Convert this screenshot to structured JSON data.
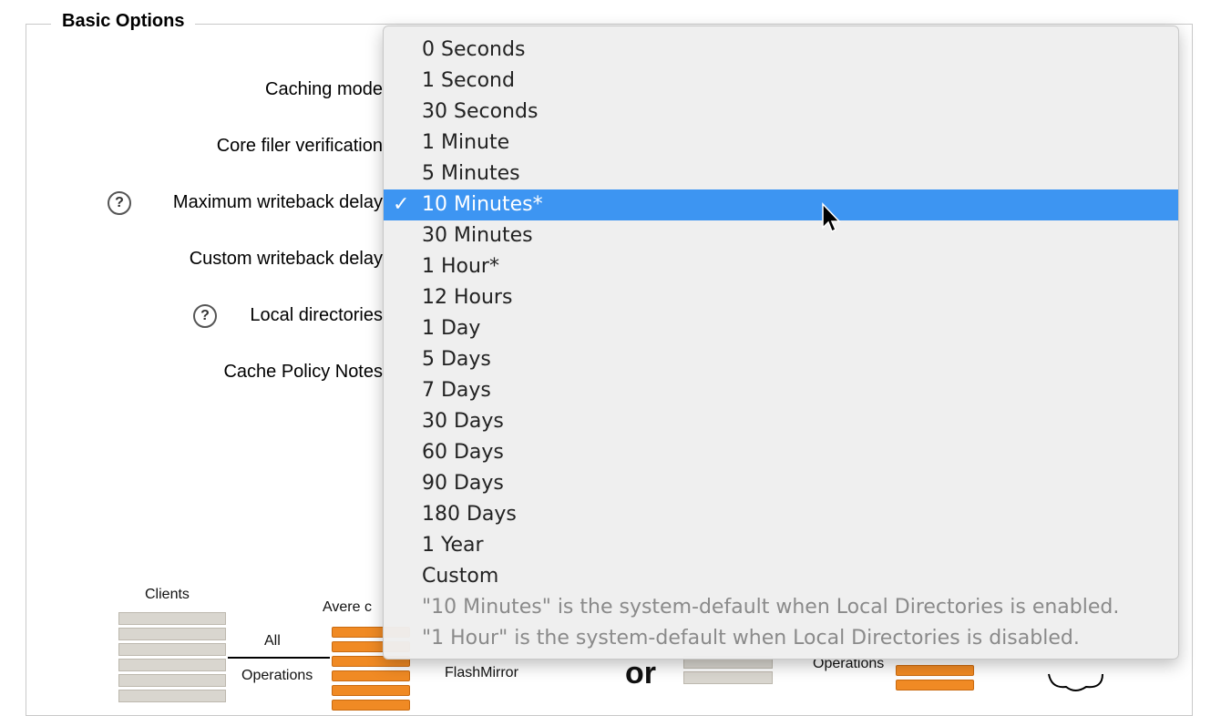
{
  "fieldset": {
    "legend": "Basic Options",
    "fields": [
      {
        "label": "Caching mode",
        "help": false
      },
      {
        "label": "Core filer verification",
        "help": false
      },
      {
        "label": "Maximum writeback delay",
        "help": true
      },
      {
        "label": "Custom writeback delay",
        "help": false
      },
      {
        "label": "Local directories",
        "help": true
      },
      {
        "label": "Cache Policy Notes",
        "help": false
      }
    ]
  },
  "diagram": {
    "clients_label": "Clients",
    "avere_label": "Avere c",
    "all_label": "All",
    "operations_label": "Operations",
    "flashmirror_label": "FlashMirror",
    "or_label": "or",
    "right_operations_label": "Operations"
  },
  "dropdown": {
    "options": [
      "0 Seconds",
      "1 Second",
      "30 Seconds",
      "1 Minute",
      "5 Minutes",
      "10 Minutes*",
      "30 Minutes",
      "1 Hour*",
      "12 Hours",
      "1 Day",
      "5 Days",
      "7 Days",
      "30 Days",
      "60 Days",
      "90 Days",
      "180 Days",
      "1 Year",
      "Custom"
    ],
    "selected_index": 5,
    "check_glyph": "✓",
    "notes": [
      "\"10 Minutes\" is the system-default when Local Directories is enabled.",
      "\"1 Hour\" is the system-default when Local Directories is disabled."
    ],
    "selected_color": "#3d95f2"
  }
}
